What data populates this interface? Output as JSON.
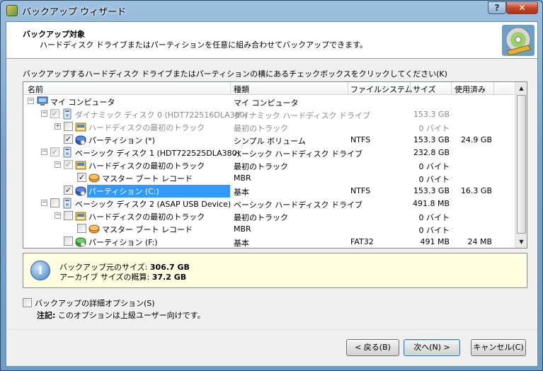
{
  "window": {
    "title": "バックアップ ウィザード",
    "help_label": "?",
    "close_label": "✕"
  },
  "header": {
    "title": "バックアップ対象",
    "subtitle": "ハードディスク ドライブまたはパーティションを任意に組み合わせてバックアップできます。"
  },
  "instruction": "バックアップするハードディスク ドライブまたはパーティションの横にあるチェックボックスをクリックしてください(K)",
  "columns": {
    "name": "名前",
    "type": "種類",
    "fs": "ファイルシステム",
    "size": "サイズ",
    "used": "使用済み"
  },
  "rows": [
    {
      "name": "マイ コンピュータ",
      "type": "マイ コンピュータ",
      "fs": "",
      "size": "",
      "used": "",
      "level": 0,
      "expander": "−",
      "check": "none",
      "icon": "computer-icon",
      "muted": false,
      "selected": false
    },
    {
      "name": "ダイナミック ディスク 0 (HDT722516DLA380)",
      "type": "ダイナミック ハードディスク ドライブ",
      "fs": "",
      "size": "153.3 GB",
      "used": "",
      "level": 1,
      "expander": "−",
      "check": "checked-dim",
      "icon": "hard-disk-icon",
      "muted": true,
      "selected": false
    },
    {
      "name": "ハードディスクの最初のトラック",
      "type": "最初のトラック",
      "fs": "",
      "size": "0 バイト",
      "used": "",
      "level": 2,
      "expander": "+",
      "check": "unchecked",
      "icon": "track-icon",
      "muted": true,
      "selected": false
    },
    {
      "name": "パーティション (*)",
      "type": "シンプル ボリューム",
      "fs": "NTFS",
      "size": "153.3 GB",
      "used": "24.9 GB",
      "level": 2,
      "expander": "",
      "check": "checked",
      "icon": "partition-icon",
      "muted": false,
      "selected": false
    },
    {
      "name": "ベーシック ディスク 1 (HDT722525DLA380)",
      "type": "ベーシック ハードディスク ドライブ",
      "fs": "",
      "size": "232.8 GB",
      "used": "",
      "level": 1,
      "expander": "−",
      "check": "checked-dim",
      "icon": "hard-disk-icon",
      "muted": false,
      "selected": false
    },
    {
      "name": "ハードディスクの最初のトラック",
      "type": "最初のトラック",
      "fs": "",
      "size": "0 バイト",
      "used": "",
      "level": 2,
      "expander": "−",
      "check": "checked-dim",
      "icon": "track-icon",
      "muted": false,
      "selected": false
    },
    {
      "name": "マスター ブート レコード",
      "type": "MBR",
      "fs": "",
      "size": "0 バイト",
      "used": "",
      "level": 3,
      "expander": "",
      "check": "checked",
      "icon": "mbr-icon",
      "muted": false,
      "selected": false
    },
    {
      "name": "パーティション (C:)",
      "type": "基本",
      "fs": "NTFS",
      "size": "153.3 GB",
      "used": "16.3 GB",
      "level": 2,
      "expander": "",
      "check": "checked",
      "icon": "partition-icon",
      "muted": false,
      "selected": true
    },
    {
      "name": "ベーシック ディスク 2 (ASAP USB Device)",
      "type": "ベーシック ハードディスク ドライブ",
      "fs": "",
      "size": "491.8 MB",
      "used": "",
      "level": 1,
      "expander": "−",
      "check": "unchecked",
      "icon": "hard-disk-icon",
      "muted": false,
      "selected": false
    },
    {
      "name": "ハードディスクの最初のトラック",
      "type": "最初のトラック",
      "fs": "",
      "size": "0 バイト",
      "used": "",
      "level": 2,
      "expander": "−",
      "check": "unchecked",
      "icon": "track-icon",
      "muted": false,
      "selected": false
    },
    {
      "name": "マスター ブート レコード",
      "type": "MBR",
      "fs": "",
      "size": "0 バイト",
      "used": "",
      "level": 3,
      "expander": "",
      "check": "unchecked",
      "icon": "mbr-icon",
      "muted": false,
      "selected": false
    },
    {
      "name": "パーティション (F:)",
      "type": "基本",
      "fs": "FAT32",
      "size": "491 MB",
      "used": "24 MB",
      "level": 2,
      "expander": "",
      "check": "unchecked",
      "icon": "partition-green-icon",
      "muted": false,
      "selected": false
    }
  ],
  "info": {
    "source_size_label": "バックアップ元のサイズ:",
    "source_size_value": "306.7 GB",
    "archive_size_label": "アーカイブ サイズの概算:",
    "archive_size_value": "37.2 GB"
  },
  "options": {
    "advanced_label": "バックアップの詳細オプション(S)",
    "note_label": "注記:",
    "note_text": "このオプションは上級ユーザー向けです。"
  },
  "buttons": {
    "back": "< 戻る(B)",
    "next": "次へ(N) >",
    "cancel": "キャンセル(C)"
  },
  "colors": {
    "selection": "#3399ff",
    "info_bg": "#ffffe1",
    "header_bg": "#ffffff"
  }
}
